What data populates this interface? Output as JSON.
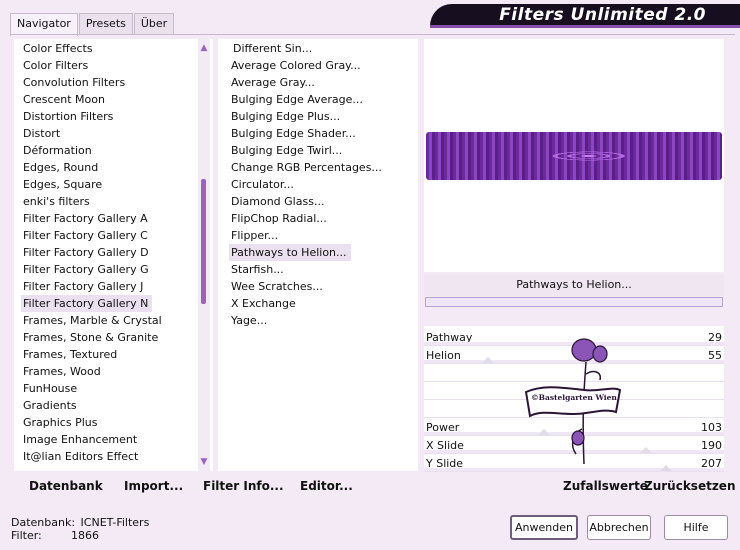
{
  "tabs": [
    "Navigator",
    "Presets",
    "Über"
  ],
  "banner_title": "Filters Unlimited 2.0",
  "categories": [
    "Color Effects",
    "Color Filters",
    "Convolution Filters",
    "Crescent Moon",
    "Distortion Filters",
    "Distort",
    "Déformation",
    "Edges, Round",
    "Edges, Square",
    "enki's filters",
    "Filter Factory Gallery A",
    "Filter Factory Gallery C",
    "Filter Factory Gallery D",
    "Filter Factory Gallery G",
    "Filter Factory Gallery J",
    "Filter Factory Gallery N",
    "Frames, Marble & Crystal",
    "Frames, Stone & Granite",
    "Frames, Textured",
    "Frames, Wood",
    "FunHouse",
    "Gradients",
    "Graphics Plus",
    "Image Enhancement",
    "It@lian Editors Effect"
  ],
  "selected_category": "Filter Factory Gallery N",
  "filters": [
    "Different Sin...",
    "Average Colored Gray...",
    "Average Gray...",
    "Bulging Edge Average...",
    "Bulging Edge Plus...",
    "Bulging Edge Shader...",
    "Bulging Edge Twirl...",
    "Change RGB Percentages...",
    "Circulator...",
    "Diamond Glass...",
    "FlipChop Radial...",
    "Flipper...",
    "Pathways to Helion...",
    "Starfish...",
    "Wee Scratches...",
    "X Exchange",
    "Yage..."
  ],
  "selected_filter": "Pathways to Helion...",
  "preview_filter_name": "Pathways to Helion...",
  "params": [
    {
      "label": "Pathway",
      "value": "29"
    },
    {
      "label": "Helion",
      "value": "55"
    },
    {
      "label": "",
      "value": ""
    },
    {
      "label": "",
      "value": ""
    },
    {
      "label": "",
      "value": ""
    },
    {
      "label": "Power",
      "value": "103"
    },
    {
      "label": "X Slide",
      "value": "190"
    },
    {
      "label": "Y Slide",
      "value": "207"
    }
  ],
  "watermark_text": "©Bastelgarten Wien",
  "left_buttons": [
    "Datenbank",
    "Import...",
    "Filter Info...",
    "Editor..."
  ],
  "right_buttons": [
    "Zufallswerte",
    "Zurücksetzen"
  ],
  "status": {
    "database_label": "Datenbank:",
    "database_value": "ICNET-Filters",
    "filter_label": "Filter:",
    "filter_value": "1866"
  },
  "dialog_buttons": [
    "Anwenden",
    "Abbrechen",
    "Hilfe"
  ],
  "colors": {
    "accent": "#9b63c0",
    "banner": "#170f1f",
    "background": "#f4eaf6"
  }
}
